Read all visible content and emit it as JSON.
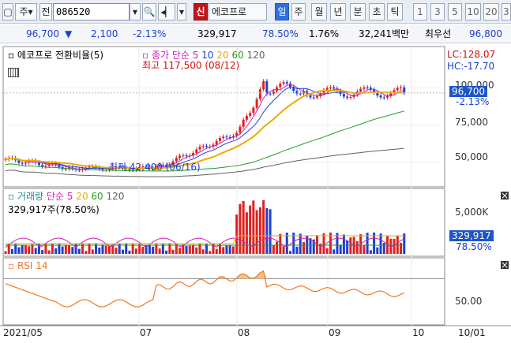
{
  "toolbar": {
    "type_select": "주",
    "type_pre": "전",
    "code": "086520",
    "name_badge": "신",
    "stock_name": "에코프로",
    "periods": [
      "일",
      "주",
      "월",
      "년",
      "분",
      "초",
      "틱"
    ],
    "active_period": "일",
    "minute_options": [
      "1",
      "3",
      "5",
      "10",
      "20",
      "3"
    ]
  },
  "quote": {
    "price": "96,700",
    "direction": "▼",
    "change": "2,100",
    "change_pct": "-2.13%",
    "volume": "329,917",
    "vol_ratio": "78.50%",
    "turnover": "1.76%",
    "amount": "32,241백만",
    "best_ask_label": "최우선",
    "best_ask": "96,800"
  },
  "price_panel": {
    "title": "에코프로 전환비율(5)",
    "ma_label": "종가 단순",
    "ma_periods": [
      "5",
      "10",
      "20",
      "60",
      "120"
    ],
    "high_note": "최고 117,500 (08/12)",
    "low_note": "최저 42,400 (06/16)",
    "lc": "LC:128.07",
    "hc": "HC:-17.70",
    "y_ticks": [
      "100,000",
      "75,000",
      "50,000"
    ],
    "current_price": "96,700",
    "current_change": "-2.13%"
  },
  "volume_panel": {
    "title": "거래량",
    "ma_label": "단순",
    "ma_periods": [
      "5",
      "20",
      "60",
      "120"
    ],
    "volume_note": "329,917주(78.50%)",
    "y_tick": "5,000K",
    "current_volume": "329,917",
    "current_pct": "78.50%"
  },
  "rsi_panel": {
    "title": "RSI 14",
    "y_tick": "50.00"
  },
  "x_axis": {
    "labels": [
      "2021/05",
      "07",
      "08",
      "09",
      "10",
      "10/01"
    ]
  },
  "colors": {
    "up": "#e02020",
    "down": "#1c3fd2",
    "ma5": "#d020c0",
    "ma10": "#2040e0",
    "ma20": "#f0a800",
    "ma60": "#20a020",
    "ma120": "#606060",
    "rsi": "#f07820"
  }
}
